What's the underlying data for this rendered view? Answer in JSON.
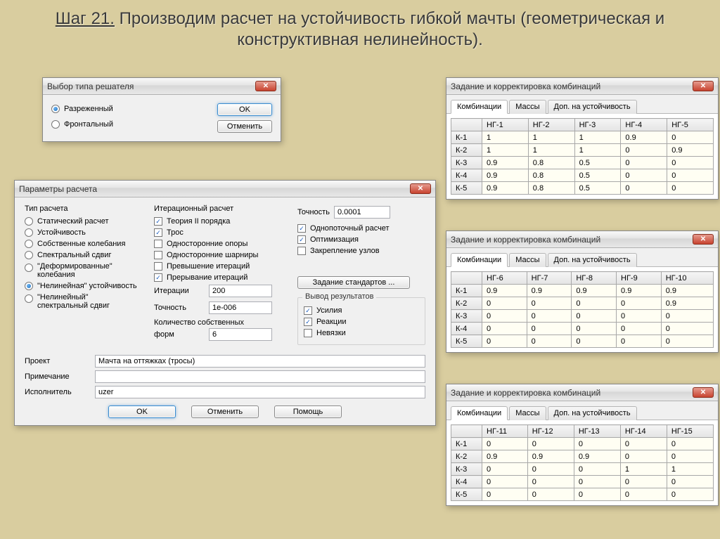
{
  "slide_title": {
    "step": "Шаг 21.",
    "rest": " Производим расчет на устойчивость гибкой мачты (геометрическая и конструктивная нелинейность)."
  },
  "solver_dialog": {
    "title": "Выбор типа решателя",
    "opt_sparse": "Разреженный",
    "opt_frontal": "Фронтальный",
    "ok": "OK",
    "cancel": "Отменить"
  },
  "params_dialog": {
    "title": "Параметры расчета",
    "calc_type_legend": "Тип расчета",
    "calc_types": {
      "static": "Статический расчет",
      "stability": "Устойчивость",
      "eigen": "Собственные колебания",
      "spectral": "Спектральный сдвиг",
      "deformed_a": "\"Деформированные\"",
      "deformed_b": "колебания",
      "nonlin_stab": "\"Нелинейная\" устойчивость",
      "nonlin_spec_a": "\"Нелинейный\"",
      "nonlin_spec_b": "спектральный сдвиг"
    },
    "iter_legend": "Итерационный расчет",
    "iter": {
      "theory2": "Теория II порядка",
      "cable": "Трос",
      "one_side_supports": "Односторонние опоры",
      "one_side_hinges": "Односторонние шарниры",
      "iter_excess": "Превышение итераций",
      "iter_break": "Прерывание итераций",
      "iterations_label": "Итерации",
      "iterations_value": "200",
      "precision_label": "Точность",
      "precision_value": "1e-006",
      "eigen_count_a": "Количество собственных",
      "eigen_count_b": "форм",
      "eigen_count_value": "6"
    },
    "right": {
      "precision_label": "Точность",
      "precision_value": "0.0001",
      "single_thread": "Однопоточный расчет",
      "optimization": "Оптимизация",
      "fix_nodes": "Закрепление узлов",
      "standards_btn": "Задание стандартов ...",
      "results_legend": "Вывод результатов",
      "forces": "Усилия",
      "reactions": "Реакции",
      "residuals": "Невязки"
    },
    "bottom": {
      "project_label": "Проект",
      "project_value": "Мачта на оттяжках (тросы)",
      "note_label": "Примечание",
      "note_value": "",
      "user_label": "Исполнитель",
      "user_value": "uzer",
      "ok": "OK",
      "cancel": "Отменить",
      "help": "Помощь"
    }
  },
  "combos_title": "Задание и корректировка комбинаций",
  "combos_tabs": {
    "combos": "Комбинации",
    "masses": "Массы",
    "stab": "Доп. на устойчивость"
  },
  "row_labels": [
    "К-1",
    "К-2",
    "К-3",
    "К-4",
    "К-5"
  ],
  "combos1": {
    "headers": [
      "НГ-1",
      "НГ-2",
      "НГ-3",
      "НГ-4",
      "НГ-5"
    ],
    "rows": [
      [
        "1",
        "1",
        "1",
        "0.9",
        "0"
      ],
      [
        "1",
        "1",
        "1",
        "0",
        "0.9"
      ],
      [
        "0.9",
        "0.8",
        "0.5",
        "0",
        "0"
      ],
      [
        "0.9",
        "0.8",
        "0.5",
        "0",
        "0"
      ],
      [
        "0.9",
        "0.8",
        "0.5",
        "0",
        "0"
      ]
    ]
  },
  "combos2": {
    "headers": [
      "НГ-6",
      "НГ-7",
      "НГ-8",
      "НГ-9",
      "НГ-10"
    ],
    "rows": [
      [
        "0.9",
        "0.9",
        "0.9",
        "0.9",
        "0.9"
      ],
      [
        "0",
        "0",
        "0",
        "0",
        "0.9"
      ],
      [
        "0",
        "0",
        "0",
        "0",
        "0"
      ],
      [
        "0",
        "0",
        "0",
        "0",
        "0"
      ],
      [
        "0",
        "0",
        "0",
        "0",
        "0"
      ]
    ]
  },
  "combos3": {
    "headers": [
      "НГ-11",
      "НГ-12",
      "НГ-13",
      "НГ-14",
      "НГ-15"
    ],
    "rows": [
      [
        "0",
        "0",
        "0",
        "0",
        "0"
      ],
      [
        "0.9",
        "0.9",
        "0.9",
        "0",
        "0"
      ],
      [
        "0",
        "0",
        "0",
        "1",
        "1"
      ],
      [
        "0",
        "0",
        "0",
        "0",
        "0"
      ],
      [
        "0",
        "0",
        "0",
        "0",
        "0"
      ]
    ]
  }
}
